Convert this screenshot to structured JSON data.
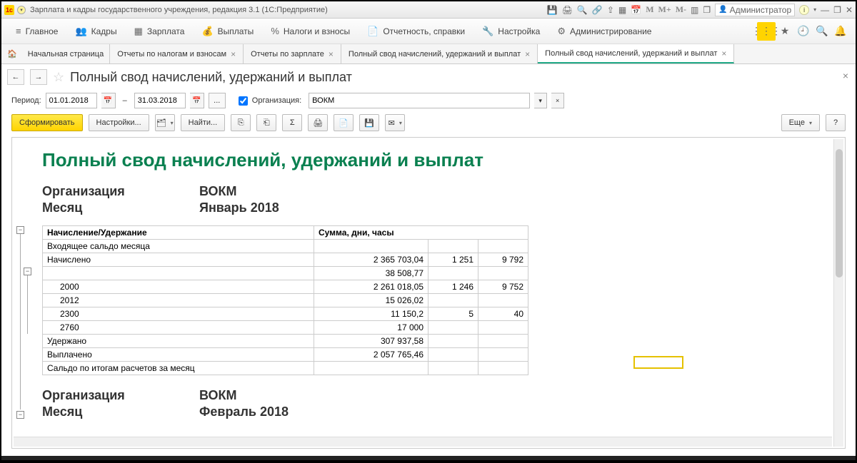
{
  "title": "Зарплата и кадры государственного учреждения, редакция 3.1  (1С:Предприятие)",
  "user": "Администратор",
  "menu": {
    "main": "Главное",
    "kadry": "Кадры",
    "zarplata": "Зарплата",
    "vyplaty": "Выплаты",
    "nalogi": "Налоги и взносы",
    "otchet": "Отчетность, справки",
    "nastr": "Настройка",
    "admin": "Администрирование"
  },
  "tabs": {
    "home": "Начальная страница",
    "t1": "Отчеты по налогам и взносам",
    "t2": "Отчеты по зарплате",
    "t3": "Полный свод начислений, удержаний и выплат",
    "t4": "Полный свод начислений, удержаний и выплат"
  },
  "pageTitle": "Полный свод начислений, удержаний и выплат",
  "filters": {
    "periodLbl": "Период:",
    "from": "01.01.2018",
    "to": "31.03.2018",
    "dash": "–",
    "orgLbl": "Организация:",
    "org": "ВОКМ"
  },
  "buttons": {
    "form": "Сформировать",
    "settings": "Настройки...",
    "find": "Найти...",
    "more": "Еще"
  },
  "report": {
    "title": "Полный свод начислений, удержаний и выплат",
    "orgLbl": "Организация",
    "org": "ВОКМ",
    "monthLbl": "Месяц",
    "month1": "Январь 2018",
    "month2": "Февраль 2018",
    "h1": "Начисление/Удержание",
    "h2": "Сумма, дни, часы",
    "r_saldo_in": "Входящее сальдо месяца",
    "r_nach": "Начислено",
    "nach_sum": "2 365 703,04",
    "nach_d": "1 251",
    "nach_h": "9 792",
    "r_blank_sum": "38 508,77",
    "r_2000": "2000",
    "s_2000": "2 261 018,05",
    "d_2000": "1 246",
    "h_2000": "9 752",
    "r_2012": "2012",
    "s_2012": "15 026,02",
    "r_2300": "2300",
    "s_2300": "11 150,2",
    "d_2300": "5",
    "h_2300": "40",
    "r_2760": "2760",
    "s_2760": "17 000",
    "r_uder": "Удержано",
    "s_uder": "307 937,58",
    "r_vypl": "Выплачено",
    "s_vypl": "2 057 765,46",
    "r_saldo": "Сальдо по итогам расчетов за месяц"
  }
}
